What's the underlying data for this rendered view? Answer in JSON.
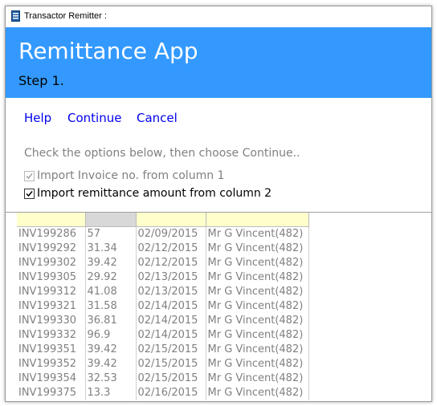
{
  "window": {
    "title": "Transactor Remitter :"
  },
  "banner": {
    "app_title": "Remittance App",
    "step": "Step 1."
  },
  "menu": {
    "help": "Help",
    "continue": "Continue",
    "cancel": "Cancel"
  },
  "instructions": "Check the options below, then choose Continue..",
  "options": [
    {
      "label": "Import Invoice no. from column 1",
      "checked": true,
      "enabled": false
    },
    {
      "label": "Import remittance amount from column 2",
      "checked": true,
      "enabled": true
    }
  ],
  "grid": {
    "headers": [
      "",
      "",
      "",
      ""
    ],
    "rows": [
      [
        "INV199286",
        "57",
        "02/09/2015",
        "Mr G Vincent(482)"
      ],
      [
        "INV199292",
        "31.34",
        "02/12/2015",
        "Mr G Vincent(482)"
      ],
      [
        "INV199302",
        "39.42",
        "02/12/2015",
        "Mr G Vincent(482)"
      ],
      [
        "INV199305",
        "29.92",
        "02/13/2015",
        "Mr G Vincent(482)"
      ],
      [
        "INV199312",
        "41.08",
        "02/13/2015",
        "Mr G Vincent(482)"
      ],
      [
        "INV199321",
        "31.58",
        "02/14/2015",
        "Mr G Vincent(482)"
      ],
      [
        "INV199330",
        "36.81",
        "02/14/2015",
        "Mr G Vincent(482)"
      ],
      [
        "INV199332",
        "96.9",
        "02/14/2015",
        "Mr G Vincent(482)"
      ],
      [
        "INV199351",
        "39.42",
        "02/15/2015",
        "Mr G Vincent(482)"
      ],
      [
        "INV199352",
        "39.42",
        "02/15/2015",
        "Mr G Vincent(482)"
      ],
      [
        "INV199354",
        "32.53",
        "02/15/2015",
        "Mr G Vincent(482)"
      ],
      [
        "INV199375",
        "13.3",
        "02/16/2015",
        "Mr G Vincent(482)"
      ]
    ]
  },
  "colors": {
    "banner": "#3399ff",
    "link": "#0000ee",
    "header_yellow": "#ffffcc",
    "header_gray": "#d8d8d8",
    "muted_text": "#808080"
  },
  "icons": {
    "app": "document-icon",
    "check": "checkmark-icon"
  }
}
